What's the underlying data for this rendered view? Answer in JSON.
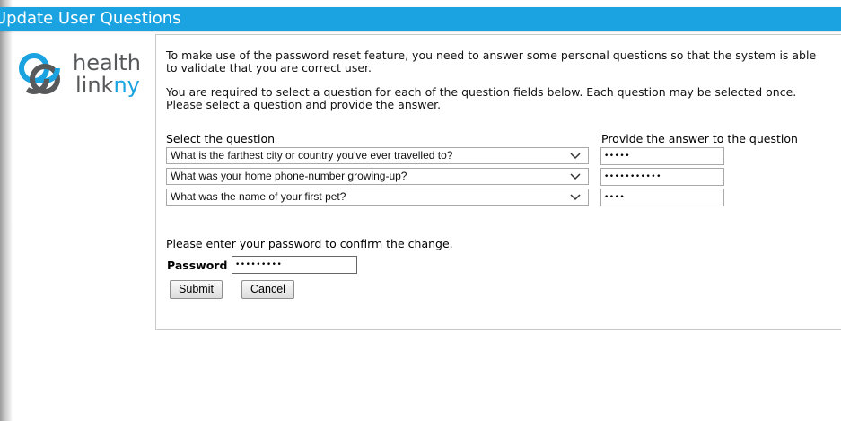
{
  "window": {
    "title": "Update User Questions"
  },
  "logo": {
    "line1": "health",
    "line2_prefix": "link",
    "line2_accent": "ny"
  },
  "intro": {
    "paragraph1": "To make use of the password reset feature, you need to answer some personal questions so that the system is able to validate that you are correct user.",
    "paragraph2": "You are required to select a question for each of the question fields below. Each question may be selected once. Please select a question and provide the answer."
  },
  "table": {
    "question_header": "Select the question",
    "answer_header": "Provide the answer to the question",
    "rows": [
      {
        "question": "What is the farthest city or country you've ever travelled to?",
        "answer_mask": "•••••"
      },
      {
        "question": "What was your home phone-number growing-up?",
        "answer_mask": "•••••••••••"
      },
      {
        "question": "What was the name of your first pet?",
        "answer_mask": "••••"
      }
    ]
  },
  "confirm": {
    "text": "Please enter your password to confirm the change.",
    "password_label": "Password",
    "password_mask": "•••••••••"
  },
  "buttons": {
    "submit": "Submit",
    "cancel": "Cancel"
  },
  "colors": {
    "accent": "#1aa3e0",
    "logo_gray": "#58595b"
  },
  "icons": {
    "dropdown": "chevron-down-icon",
    "logo": "healthlinkny-logo-icon"
  }
}
